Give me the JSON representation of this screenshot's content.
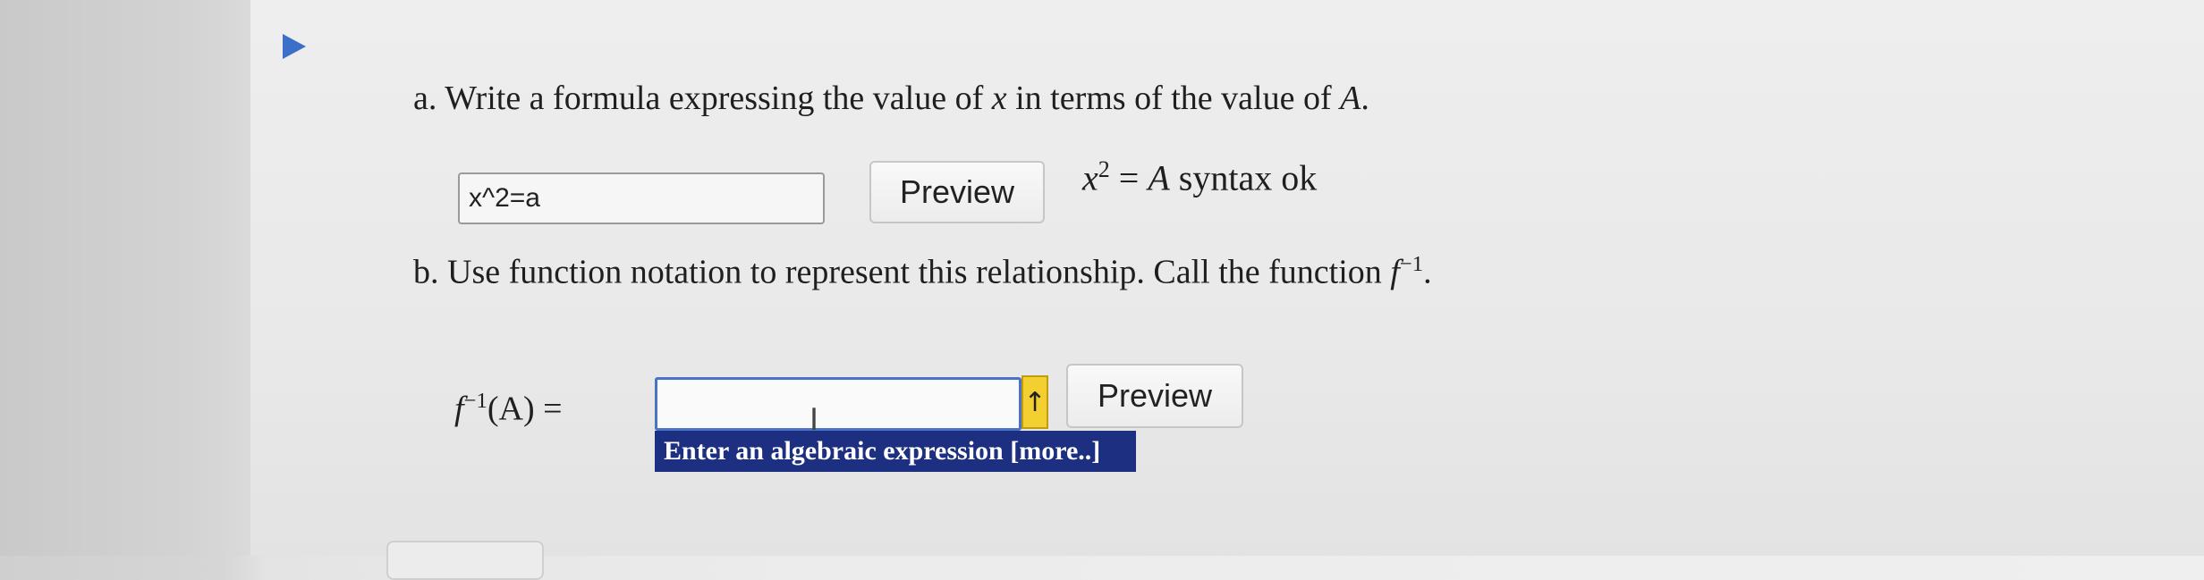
{
  "part_a": {
    "prefix": "a.",
    "question_text_1": "Write a formula expressing the value of",
    "question_var_x": "x",
    "question_text_2": "in terms of the value of",
    "question_var_A": "A",
    "question_text_end": ".",
    "input_value": "x^2=a",
    "preview_label": "Preview",
    "result_base": "x",
    "result_exp": "2",
    "result_eq": "=",
    "result_var": "A",
    "result_status": "syntax ok"
  },
  "part_b": {
    "prefix": "b.",
    "question_text": "Use function notation to represent this relationship. Call the function",
    "function_name": "f",
    "function_exp": "−1",
    "question_text_end": ".",
    "label_f": "f",
    "label_exp": "−1",
    "label_args": "(A) =",
    "input_value": "",
    "preview_label": "Preview",
    "arrow_glyph": "↑",
    "tooltip_text": "Enter an algebraic expression [more..]"
  },
  "icons": {
    "collapse": "play-triangle-icon",
    "cursor": "text-cursor-icon",
    "arrow": "up-arrow-icon"
  },
  "colors": {
    "accent_blue": "#3c6fc7",
    "tooltip_bg": "#1d2f80",
    "arrow_yellow": "#f3cf2f"
  }
}
